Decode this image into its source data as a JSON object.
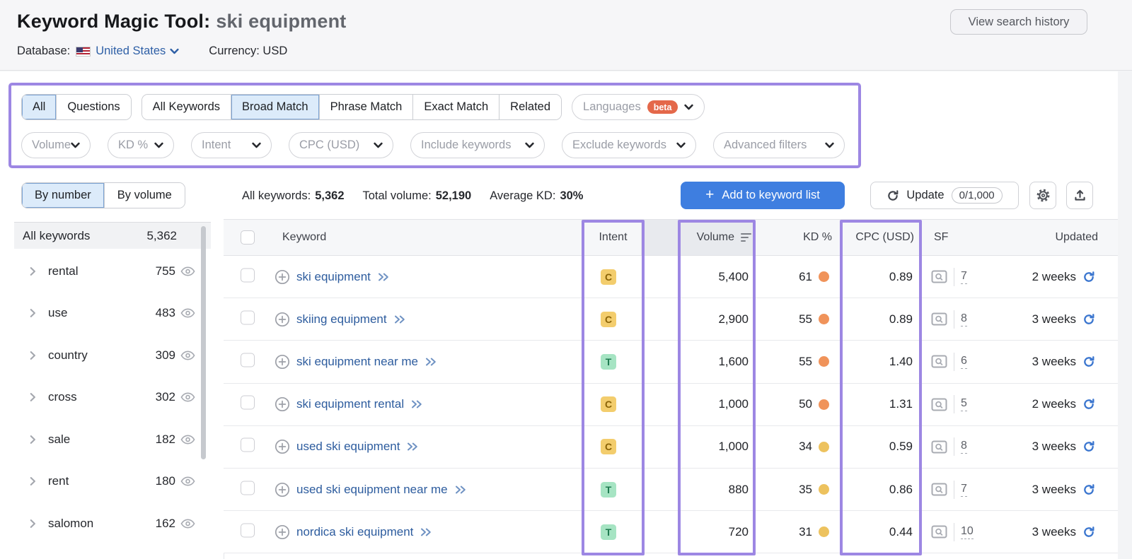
{
  "header": {
    "title": "Keyword Magic Tool:",
    "query": "ski equipment",
    "database_label": "Database:",
    "database_value": "United States",
    "currency_label": "Currency:",
    "currency_value": "USD",
    "view_history_button": "View search history"
  },
  "filters": {
    "question_tabs": [
      "All",
      "Questions"
    ],
    "question_selected": "All",
    "match_tabs": [
      "All Keywords",
      "Broad Match",
      "Phrase Match",
      "Exact Match",
      "Related"
    ],
    "match_selected": "Broad Match",
    "languages": {
      "label": "Languages",
      "badge": "beta"
    },
    "dropdowns": [
      "Volume",
      "KD %",
      "Intent",
      "CPC (USD)",
      "Include keywords",
      "Exclude keywords",
      "Advanced filters"
    ]
  },
  "sidebar": {
    "tabs": [
      "By number",
      "By volume"
    ],
    "selected_tab": "By number",
    "all_row": {
      "label": "All keywords",
      "count": "5,362"
    },
    "groups": [
      {
        "label": "rental",
        "count": "755"
      },
      {
        "label": "use",
        "count": "483"
      },
      {
        "label": "country",
        "count": "309"
      },
      {
        "label": "cross",
        "count": "302"
      },
      {
        "label": "sale",
        "count": "182"
      },
      {
        "label": "rent",
        "count": "180"
      },
      {
        "label": "salomon",
        "count": "162"
      }
    ]
  },
  "toolbar": {
    "stats": [
      {
        "label": "All keywords:",
        "value": "5,362"
      },
      {
        "label": "Total volume:",
        "value": "52,190"
      },
      {
        "label": "Average KD:",
        "value": "30%"
      }
    ],
    "add_button": "Add to keyword list",
    "update_button": "Update",
    "update_count": "0/1,000"
  },
  "table": {
    "columns": [
      "Keyword",
      "Intent",
      "Volume",
      "KD %",
      "CPC (USD)",
      "SF",
      "Updated"
    ],
    "rows": [
      {
        "keyword": "ski equipment",
        "intent": "C",
        "volume": "5,400",
        "kd": "61",
        "kd_color": "#f0935a",
        "cpc": "0.89",
        "sf": "7",
        "updated": "2 weeks"
      },
      {
        "keyword": "skiing equipment",
        "intent": "C",
        "volume": "2,900",
        "kd": "55",
        "kd_color": "#f0935a",
        "cpc": "0.89",
        "sf": "8",
        "updated": "3 weeks"
      },
      {
        "keyword": "ski equipment near me",
        "intent": "T",
        "volume": "1,600",
        "kd": "55",
        "kd_color": "#f0935a",
        "cpc": "1.40",
        "sf": "6",
        "updated": "3 weeks"
      },
      {
        "keyword": "ski equipment rental",
        "intent": "C",
        "volume": "1,000",
        "kd": "50",
        "kd_color": "#f0935a",
        "cpc": "1.31",
        "sf": "5",
        "updated": "2 weeks"
      },
      {
        "keyword": "used ski equipment",
        "intent": "C",
        "volume": "1,000",
        "kd": "34",
        "kd_color": "#edc25e",
        "cpc": "0.59",
        "sf": "8",
        "updated": "3 weeks"
      },
      {
        "keyword": "used ski equipment near me",
        "intent": "T",
        "volume": "880",
        "kd": "35",
        "kd_color": "#edc25e",
        "cpc": "0.86",
        "sf": "7",
        "updated": "3 weeks"
      },
      {
        "keyword": "nordica ski equipment",
        "intent": "T",
        "volume": "720",
        "kd": "31",
        "kd_color": "#edc25e",
        "cpc": "0.44",
        "sf": "10",
        "updated": "3 weeks"
      }
    ],
    "intent_colors": {
      "C": {
        "bg": "#f3cd6d",
        "text": "#8a6307"
      },
      "T": {
        "bg": "#a6e4c3",
        "text": "#1f7a50"
      }
    }
  },
  "colors": {
    "accent_purple": "#9d87e3",
    "primary_blue": "#3e7ee0",
    "beta_orange": "#e4684a",
    "link_blue": "#2d5c9e",
    "refresh_blue": "#3b76cf"
  }
}
